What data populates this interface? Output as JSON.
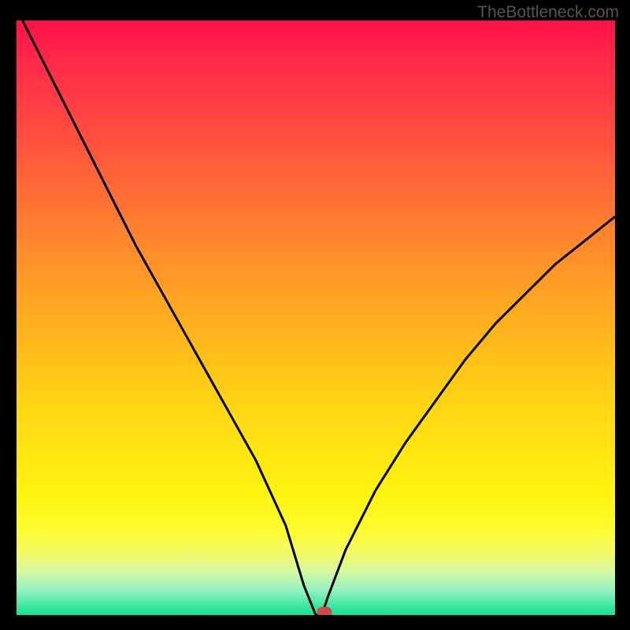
{
  "watermark": "TheBottleneck.com",
  "chart_data": {
    "type": "line",
    "title": "",
    "xlabel": "",
    "ylabel": "",
    "xlim": [
      0,
      100
    ],
    "ylim": [
      0,
      100
    ],
    "series": [
      {
        "name": "bottleneck-curve",
        "x": [
          1,
          5,
          10,
          15,
          20,
          25,
          30,
          35,
          40,
          45,
          48,
          50,
          51,
          52,
          55,
          60,
          65,
          70,
          75,
          80,
          85,
          90,
          95,
          100
        ],
        "values": [
          100,
          92,
          82,
          72,
          62,
          53,
          44,
          35,
          26,
          15,
          5,
          0,
          0,
          3,
          11,
          21,
          29,
          36,
          43,
          49,
          54,
          59,
          63,
          67
        ]
      }
    ],
    "marker": {
      "x": 51.5,
      "y": 0.5
    },
    "colors": {
      "gradient_top": "#ff1048",
      "gradient_bottom": "#1de090",
      "curve": "#000000",
      "marker": "#cc4b4b"
    }
  }
}
